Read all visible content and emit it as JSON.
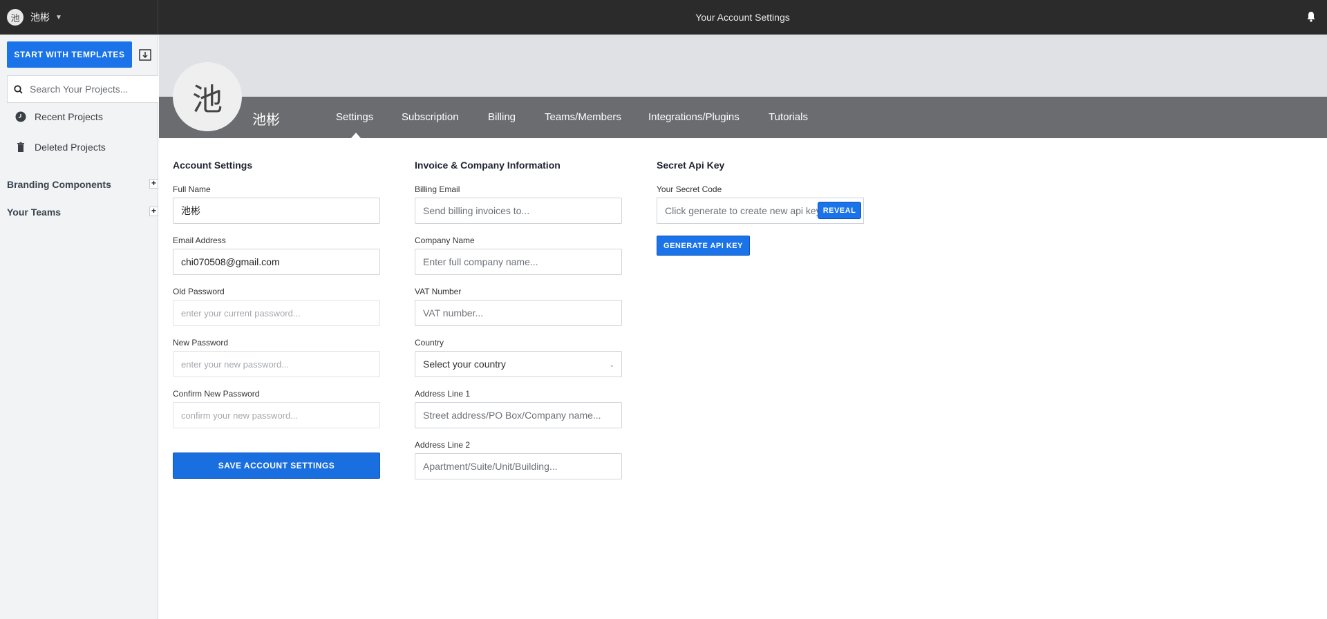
{
  "header": {
    "avatar_char": "池",
    "user_name": "池彬",
    "title": "Your Account Settings"
  },
  "sidebar": {
    "templates_button": "START WITH TEMPLATES",
    "search_placeholder": "Search Your Projects...",
    "items": [
      {
        "label": "Recent Projects",
        "icon": "clock-icon"
      },
      {
        "label": "Deleted Projects",
        "icon": "trash-icon"
      }
    ],
    "sections": [
      {
        "label": "Branding Components"
      },
      {
        "label": "Your Teams"
      }
    ]
  },
  "profile": {
    "avatar_char": "池",
    "name": "池彬"
  },
  "tabs": [
    {
      "label": "Settings",
      "active": true
    },
    {
      "label": "Subscription"
    },
    {
      "label": "Billing"
    },
    {
      "label": "Teams/Members"
    },
    {
      "label": "Integrations/Plugins"
    },
    {
      "label": "Tutorials"
    }
  ],
  "account": {
    "heading": "Account Settings",
    "full_name_label": "Full Name",
    "full_name_value": "池彬",
    "email_label": "Email Address",
    "email_value": "chi070508@gmail.com",
    "old_password_label": "Old Password",
    "old_password_placeholder": "enter your current password...",
    "new_password_label": "New Password",
    "new_password_placeholder": "enter your new password...",
    "confirm_password_label": "Confirm New Password",
    "confirm_password_placeholder": "confirm your new password...",
    "save_button": "SAVE ACCOUNT SETTINGS"
  },
  "invoice": {
    "heading": "Invoice & Company Information",
    "billing_email_label": "Billing Email",
    "billing_email_placeholder": "Send billing invoices to...",
    "company_label": "Company Name",
    "company_placeholder": "Enter full company name...",
    "vat_label": "VAT Number",
    "vat_placeholder": "VAT number...",
    "country_label": "Country",
    "country_value": "Select your country",
    "address1_label": "Address Line 1",
    "address1_placeholder": "Street address/PO Box/Company name...",
    "address2_label": "Address Line 2",
    "address2_placeholder": "Apartment/Suite/Unit/Building..."
  },
  "api": {
    "heading": "Secret Api Key",
    "code_label": "Your Secret Code",
    "code_placeholder": "Click generate to create new api key",
    "reveal_button": "REVEAL",
    "generate_button": "GENERATE API KEY"
  },
  "colors": {
    "accent": "#1a73e8",
    "topbar": "#2b2b2b",
    "tabbar": "#6b6c70"
  }
}
